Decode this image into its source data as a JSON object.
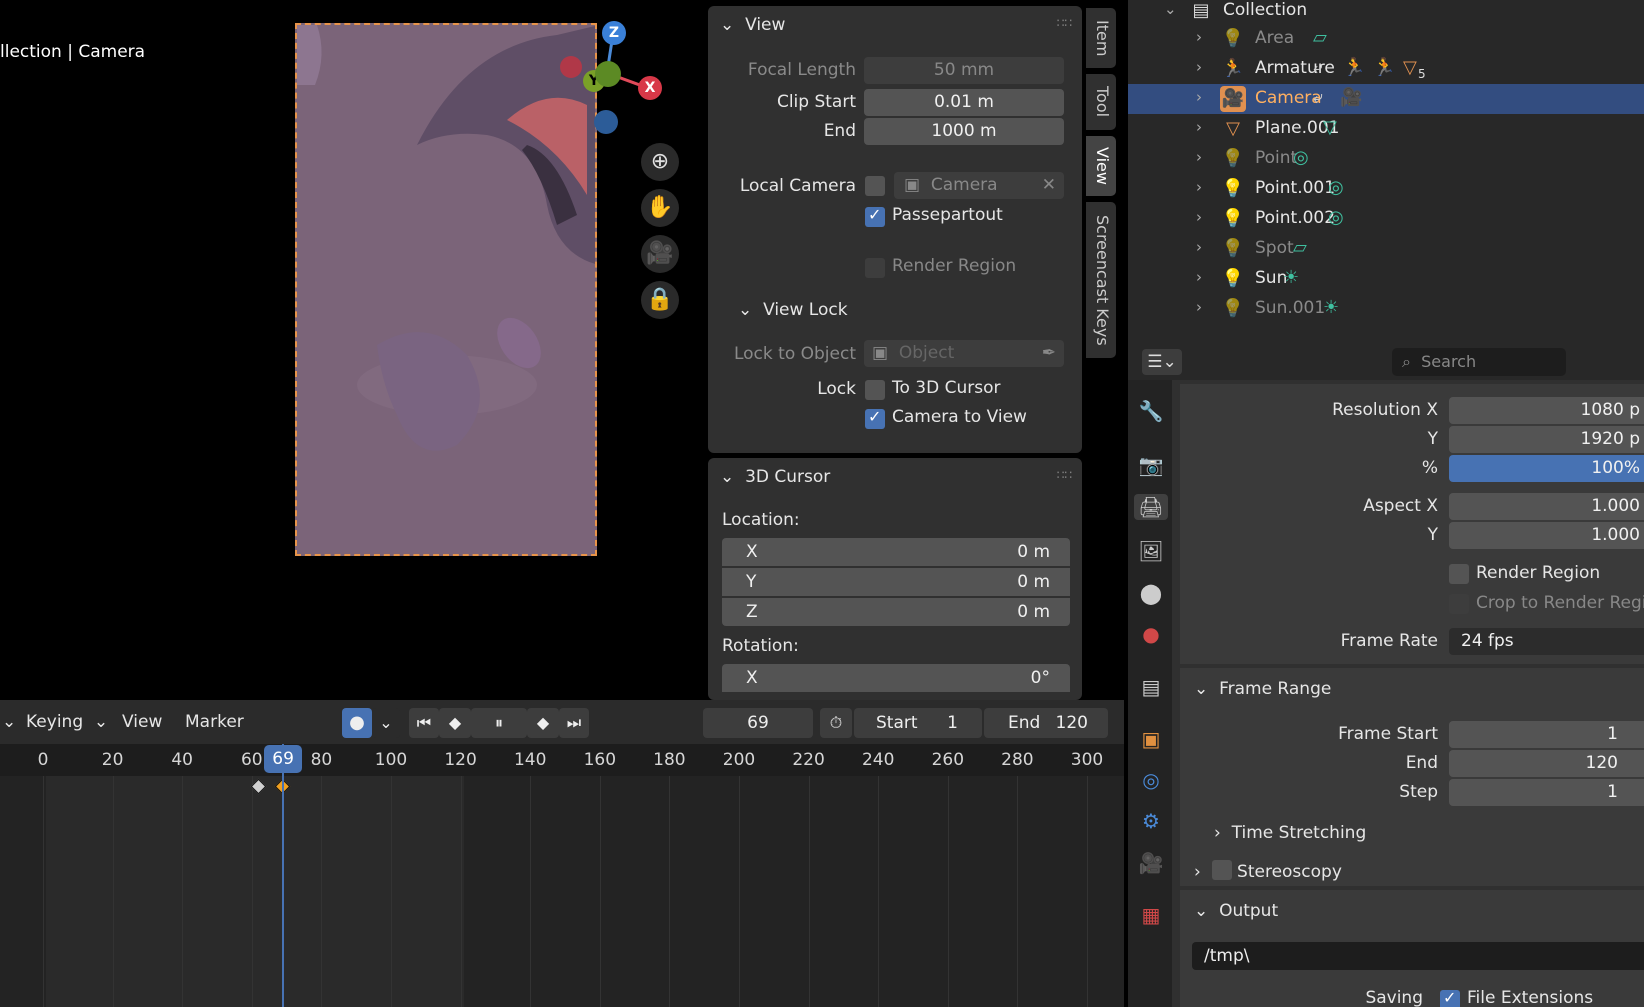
{
  "viewport": {
    "title": "llection | Camera",
    "gizmo": {
      "z": "Z",
      "y": "Y",
      "x": "X"
    },
    "nav_icons": [
      "zoom-icon",
      "hand-icon",
      "camera-icon",
      "lock-icon"
    ]
  },
  "view_panel": {
    "title": "View",
    "focal_length_label": "Focal Length",
    "focal_length_value": "50 mm",
    "clip_start_label": "Clip Start",
    "clip_start_value": "0.01 m",
    "end_label": "End",
    "end_value": "1000 m",
    "local_camera_label": "Local Camera",
    "local_camera_value": "Camera",
    "passepartout_label": "Passepartout",
    "passepartout_checked": true,
    "render_region_label": "Render Region",
    "view_lock_title": "View Lock",
    "lock_to_object_label": "Lock to Object",
    "lock_to_object_placeholder": "Object",
    "lock_label": "Lock",
    "to_3d_cursor_label": "To 3D Cursor",
    "camera_to_view_label": "Camera to View",
    "camera_to_view_checked": true
  },
  "cursor_panel": {
    "title": "3D Cursor",
    "location_label": "Location:",
    "location": [
      {
        "axis": "X",
        "value": "0 m"
      },
      {
        "axis": "Y",
        "value": "0 m"
      },
      {
        "axis": "Z",
        "value": "0 m"
      }
    ],
    "rotation_label": "Rotation:",
    "rotation": [
      {
        "axis": "X",
        "value": "0°"
      }
    ]
  },
  "side_tabs": [
    "Item",
    "Tool",
    "View",
    "Screencast Keys"
  ],
  "timeline": {
    "menus": [
      "Keying",
      "View",
      "Marker"
    ],
    "current_frame": "69",
    "start_label": "Start",
    "start_value": "1",
    "end_label": "End",
    "end_value": "120",
    "ticks": [
      "0",
      "20",
      "40",
      "60",
      "80",
      "100",
      "120",
      "140",
      "160",
      "180",
      "200",
      "220",
      "240",
      "260",
      "280",
      "300"
    ],
    "playhead": "69",
    "keyframes": [
      62,
      69
    ]
  },
  "outliner": {
    "collection": "Collection",
    "items": [
      {
        "name": "Area",
        "icon": "light-icon",
        "dim": true
      },
      {
        "name": "Armature",
        "icon": "armature-icon",
        "dim": false
      },
      {
        "name": "Camera",
        "icon": "camera-icon",
        "dim": false,
        "selected": true
      },
      {
        "name": "Plane.001",
        "icon": "mesh-icon",
        "dim": false
      },
      {
        "name": "Point",
        "icon": "light-icon",
        "dim": true
      },
      {
        "name": "Point.001",
        "icon": "light-icon",
        "dim": false
      },
      {
        "name": "Point.002",
        "icon": "light-icon",
        "dim": false
      },
      {
        "name": "Spot",
        "icon": "light-icon",
        "dim": true
      },
      {
        "name": "Sun",
        "icon": "light-icon",
        "dim": false
      },
      {
        "name": "Sun.001",
        "icon": "light-icon",
        "dim": true
      }
    ],
    "armature_badge": "5"
  },
  "properties": {
    "search_placeholder": "Search",
    "resolution_x_label": "Resolution X",
    "resolution_x_value": "1080 p",
    "resolution_y_label": "Y",
    "resolution_y_value": "1920 p",
    "percent_label": "%",
    "percent_value": "100%",
    "aspect_x_label": "Aspect X",
    "aspect_x_value": "1.000",
    "aspect_y_label": "Y",
    "aspect_y_value": "1.000",
    "render_region_label": "Render Region",
    "crop_label": "Crop to Render Regior",
    "frame_rate_label": "Frame Rate",
    "frame_rate_value": "24 fps",
    "frame_range_title": "Frame Range",
    "frame_start_label": "Frame Start",
    "frame_start_value": "1",
    "end_label": "End",
    "end_value": "120",
    "step_label": "Step",
    "step_value": "1",
    "time_stretching_title": "Time Stretching",
    "stereoscopy_title": "Stereoscopy",
    "output_title": "Output",
    "output_path": "/tmp\\",
    "saving_label": "Saving",
    "file_extensions_label": "File Extensions"
  },
  "colors": {
    "accent": "#4772b3",
    "selection": "#334d80",
    "frame_border": "#e8944a",
    "keyframe_selected": "#f0a020"
  }
}
